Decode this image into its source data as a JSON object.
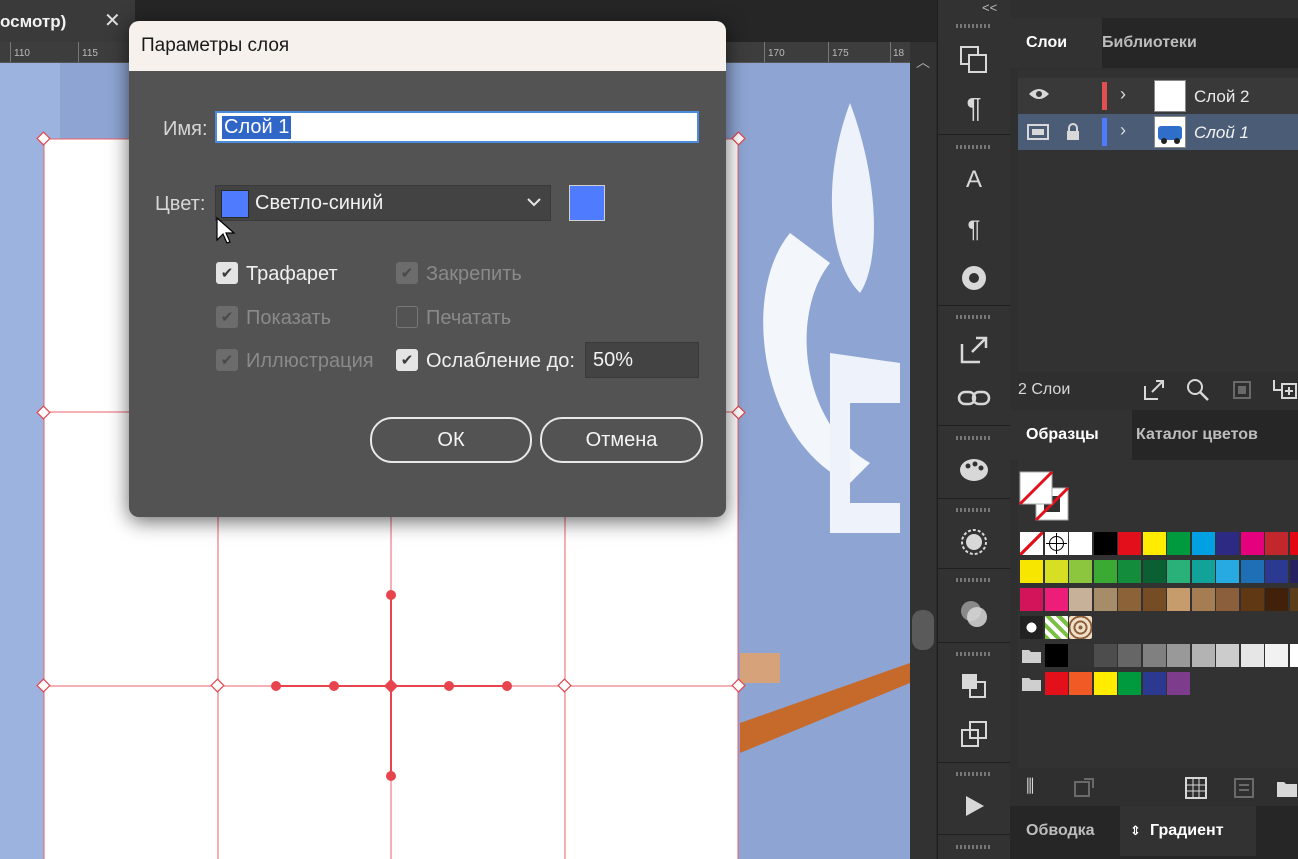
{
  "document_tab": {
    "title": "осмотр)",
    "close": "✕"
  },
  "ruler": {
    "ticks": [
      "110",
      "115",
      "170",
      "175",
      "18"
    ]
  },
  "panels": {
    "layers_tabs": [
      "Слои",
      "Библиотеки"
    ],
    "layers": [
      {
        "name": "Слой 2",
        "visible": true,
        "locked": false,
        "color": "#e05050"
      },
      {
        "name": "Слой 1",
        "visible": false,
        "locked": true,
        "color": "#4f7cff"
      }
    ],
    "layers_count": "2 Слои",
    "swatches_tabs": [
      "Образцы",
      "Каталог цветов"
    ],
    "bottom_tabs": [
      "Обводка",
      "Градиент"
    ],
    "collapse_label": "<<",
    "swatch_rows": [
      [
        "none",
        "reg",
        "#ffffff",
        "#000000",
        "#e3101c",
        "#ffec00",
        "#009a3e",
        "#00a0e3",
        "#2c2a83",
        "#e5007e",
        "#c1272d",
        "#e30613"
      ],
      [
        "#f7e600",
        "#d6df23",
        "#8cc63f",
        "#3aaa35",
        "#138d3b",
        "#0a6033",
        "#2ab179",
        "#11a29a",
        "#27a9e1",
        "#1f6fb6",
        "#2b3990",
        "#262262"
      ],
      [
        "#d4145a",
        "#ed1e79",
        "#c7b299",
        "#a68c69",
        "#8c6239",
        "#754c24",
        "#c69c6d",
        "#a67c52",
        "#8b5e3c",
        "#603813",
        "#42210b",
        "#5c3d1a"
      ],
      [
        "pattern1",
        "pattern2",
        "pattern3"
      ],
      [
        "folder",
        "#000000",
        "#333333",
        "#4d4d4d",
        "#666666",
        "#808080",
        "#999999",
        "#b3b3b3",
        "#cccccc",
        "#e6e6e6",
        "#f2f2f2",
        "#ffffff"
      ],
      [
        "folder",
        "#e3101c",
        "#f15a24",
        "#ffec00",
        "#009a3e",
        "#2c3990",
        "#7d3c8c"
      ]
    ]
  },
  "dialog": {
    "title": "Параметры слоя",
    "name_label": "Имя:",
    "name_value": "Слой 1",
    "color_label": "Цвет:",
    "color_value": "Светло-синий",
    "color_hex": "#4f7cff",
    "checkboxes": {
      "template": "Трафарет",
      "lock": "Закрепить",
      "show": "Показать",
      "print": "Печатать",
      "illustration": "Иллюстрация",
      "dim": "Ослабление до:"
    },
    "dim_value": "50%",
    "ok_label": "ОК",
    "cancel_label": "Отмена"
  }
}
